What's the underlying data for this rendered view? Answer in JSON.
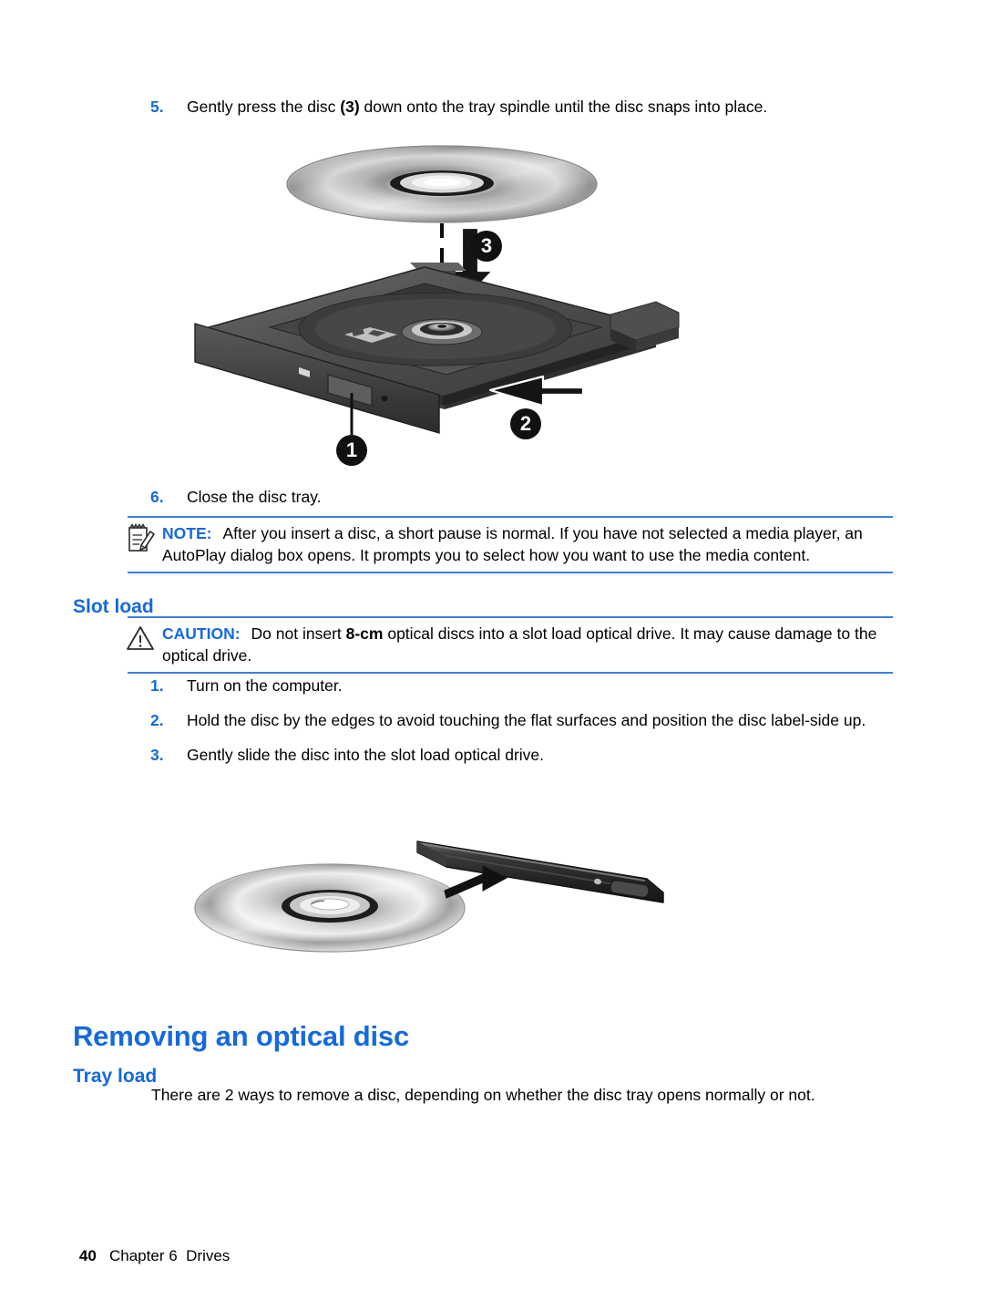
{
  "document": {
    "title": "Removing an optical disc",
    "accent_color": "#1569de",
    "rule_color": "#3d7fe0",
    "text_color": "#000000",
    "background": "#ffffff"
  },
  "steps_tray_insert": [
    {
      "number": "5.",
      "text_before": "Gently press the disc ",
      "bold": "(3)",
      "text_after": " down onto the tray spindle until the disc snaps into place."
    },
    {
      "number": "6.",
      "text_before": "Close the disc tray.",
      "bold": "",
      "text_after": ""
    }
  ],
  "note": {
    "icon": "note-pencil-icon",
    "keyword": "NOTE:",
    "text": "After you insert a disc, a short pause is normal. If you have not selected a media player, an AutoPlay dialog box opens. It prompts you to select how you want to use the media content."
  },
  "slot_load": {
    "heading": "Slot load",
    "caution": {
      "icon": "warning-triangle-icon",
      "keyword": "CAUTION:",
      "text_before": "Do not insert ",
      "bold": "8-cm",
      "text_after": " optical discs into a slot load optical drive. It may cause damage to the optical drive."
    },
    "steps": [
      {
        "number": "1.",
        "text": "Turn on the computer."
      },
      {
        "number": "2.",
        "text": "Hold the disc by the edges to avoid touching the flat surfaces and position the disc label-side up."
      },
      {
        "number": "3.",
        "text": "Gently slide the disc into the slot load optical drive."
      }
    ]
  },
  "removing": {
    "heading": "Removing an optical disc",
    "subheading": "Tray load",
    "paragraph": "There are 2 ways to remove a disc, depending on whether the disc tray opens normally or not."
  },
  "figures": {
    "tray_load_drive": {
      "name": "tray-load-optical-drive-illustration",
      "callouts": [
        "1",
        "2",
        "3"
      ],
      "parts": [
        "optical-disc",
        "disc-tray",
        "tray-spindle",
        "eject-button",
        "drive-bezel",
        "down-arrow",
        "tray-close-arrow"
      ]
    },
    "slot_load_drive": {
      "name": "slot-load-optical-drive-illustration",
      "parts": [
        "optical-disc",
        "slot-load-drive-edge",
        "insert-arrow"
      ]
    }
  },
  "footer": {
    "page_number": "40",
    "chapter": "Chapter 6",
    "section": "Drives"
  }
}
